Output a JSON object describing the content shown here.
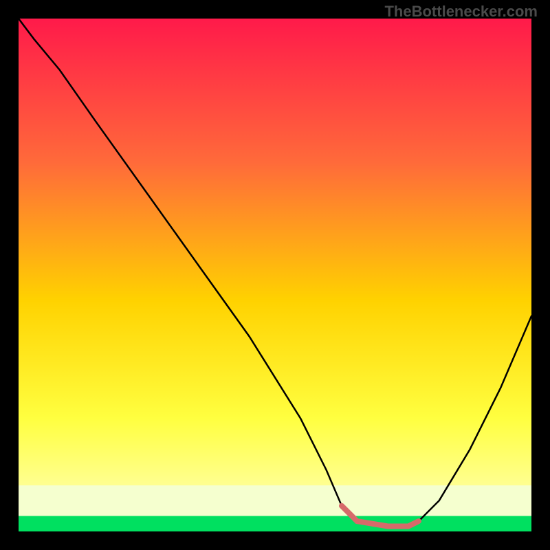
{
  "watermark": "TheBottlenecker.com",
  "chart_data": {
    "type": "line",
    "title": "",
    "xlabel": "",
    "ylabel": "",
    "xlim": [
      0,
      100
    ],
    "ylim": [
      0,
      100
    ],
    "gradient": {
      "top": "#ff1a4a",
      "mid1": "#ff7a3a",
      "mid2": "#ffd200",
      "mid3": "#ffff60",
      "bottom_band": "#f5ffcf",
      "baseline": "#00e060"
    },
    "series": [
      {
        "name": "curve",
        "color": "#000000",
        "x": [
          0,
          3,
          8,
          15,
          25,
          35,
          45,
          55,
          60,
          63,
          66,
          72,
          76,
          78,
          82,
          88,
          94,
          100
        ],
        "y": [
          100,
          96,
          90,
          80,
          66,
          52,
          38,
          22,
          12,
          5,
          2,
          1,
          1,
          2,
          6,
          16,
          28,
          42
        ]
      },
      {
        "name": "highlight",
        "color": "#d66a6a",
        "x": [
          63,
          66,
          72,
          76,
          78
        ],
        "y": [
          5,
          2,
          1,
          1,
          2
        ]
      }
    ]
  }
}
